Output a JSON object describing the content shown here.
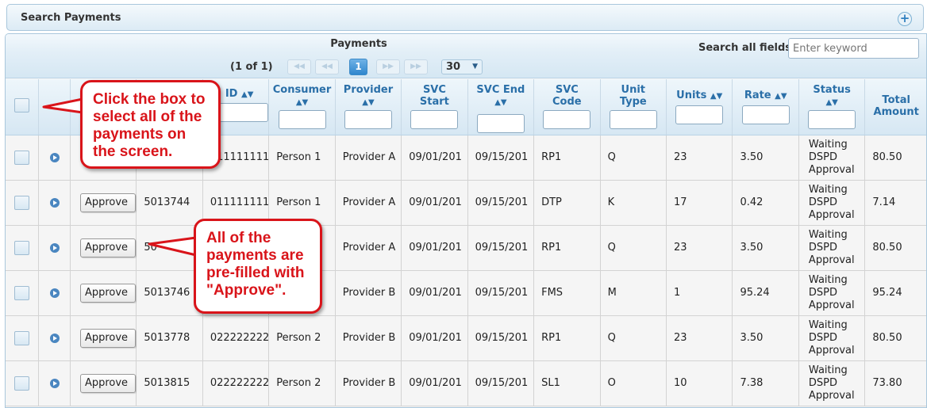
{
  "search_panel": {
    "title": "Search Payments",
    "expand_icon": "plus-circle-icon"
  },
  "grid": {
    "caption": "Payments",
    "search_label": "Search all fields:",
    "search_placeholder": "Enter keyword",
    "pager": {
      "info": "(1 of 1)",
      "first_icon": "first-page-icon",
      "prev_icon": "prev-page-icon",
      "current_page": "1",
      "next_icon": "next-page-icon",
      "last_icon": "last-page-icon",
      "page_size": "30"
    },
    "columns": [
      {
        "key": "select",
        "label": "",
        "sortable": false,
        "filter": false
      },
      {
        "key": "expand",
        "label": "",
        "sortable": false,
        "filter": false
      },
      {
        "key": "action",
        "label": "",
        "sortable": false,
        "filter": false
      },
      {
        "key": "payment_id",
        "label": "",
        "sortable": false,
        "filter": false
      },
      {
        "key": "consumer_id",
        "label": "ID",
        "sortable": true,
        "filter": true
      },
      {
        "key": "consumer",
        "label": "Consumer",
        "sortable": true,
        "filter": true
      },
      {
        "key": "provider",
        "label": "Provider",
        "sortable": true,
        "filter": true
      },
      {
        "key": "svc_start",
        "label": "SVC Start",
        "sortable": true,
        "filter": true
      },
      {
        "key": "svc_end",
        "label": "SVC End",
        "sortable": true,
        "filter": true
      },
      {
        "key": "svc_code",
        "label": "SVC Code",
        "sortable": true,
        "filter": true
      },
      {
        "key": "unit_type",
        "label": "Unit Type",
        "sortable": true,
        "filter": true
      },
      {
        "key": "units",
        "label": "Units",
        "sortable": true,
        "filter": true
      },
      {
        "key": "rate",
        "label": "Rate",
        "sortable": true,
        "filter": true
      },
      {
        "key": "status",
        "label": "Status",
        "sortable": true,
        "filter": true
      },
      {
        "key": "total",
        "label": "Total Amount",
        "sortable": false,
        "filter": false
      }
    ],
    "rows": [
      {
        "action": "",
        "payment_id": "",
        "consumer_id": "011111111",
        "consumer": "Person 1",
        "provider": "Provider A",
        "svc_start": "09/01/201",
        "svc_end": "09/15/201",
        "svc_code": "RP1",
        "unit_type": "Q",
        "units": "23",
        "rate": "3.50",
        "status": "Waiting DSPD Approval",
        "total": "80.50"
      },
      {
        "action": "Approve",
        "payment_id": "5013744",
        "consumer_id": "011111111",
        "consumer": "Person 1",
        "provider": "Provider A",
        "svc_start": "09/01/201",
        "svc_end": "09/15/201",
        "svc_code": "DTP",
        "unit_type": "K",
        "units": "17",
        "rate": "0.42",
        "status": "Waiting DSPD Approval",
        "total": "7.14"
      },
      {
        "action": "Approve",
        "payment_id": "50",
        "consumer_id": "",
        "consumer": "",
        "provider": "Provider A",
        "svc_start": "09/01/201",
        "svc_end": "09/15/201",
        "svc_code": "RP1",
        "unit_type": "Q",
        "units": "23",
        "rate": "3.50",
        "status": "Waiting DSPD Approval",
        "total": "80.50"
      },
      {
        "action": "Approve",
        "payment_id": "5013746",
        "consumer_id": "",
        "consumer": "",
        "provider": "Provider B",
        "svc_start": "09/01/201",
        "svc_end": "09/15/201",
        "svc_code": "FMS",
        "unit_type": "M",
        "units": "1",
        "rate": "95.24",
        "status": "Waiting DSPD Approval",
        "total": "95.24"
      },
      {
        "action": "Approve",
        "payment_id": "5013778",
        "consumer_id": "022222222",
        "consumer": "Person 2",
        "provider": "Provider B",
        "svc_start": "09/01/201",
        "svc_end": "09/15/201",
        "svc_code": "RP1",
        "unit_type": "Q",
        "units": "23",
        "rate": "3.50",
        "status": "Waiting DSPD Approval",
        "total": "80.50"
      },
      {
        "action": "Approve",
        "payment_id": "5013815",
        "consumer_id": "022222222",
        "consumer": "Person 2",
        "provider": "Provider B",
        "svc_start": "09/01/201",
        "svc_end": "09/15/201",
        "svc_code": "SL1",
        "unit_type": "O",
        "units": "10",
        "rate": "7.38",
        "status": "Waiting DSPD Approval",
        "total": "73.80"
      }
    ]
  },
  "callouts": {
    "select_all": "Click the box to select all of the payments on the screen.",
    "prefilled": "All of the payments are pre-filled with \"Approve\"."
  },
  "icons": {
    "sort": "sort-updown-icon",
    "expand_row": "expand-row-icon"
  },
  "colors": {
    "callout_red": "#d9141a",
    "header_text": "#2a6fa8",
    "current_page": "#2f86cd"
  }
}
